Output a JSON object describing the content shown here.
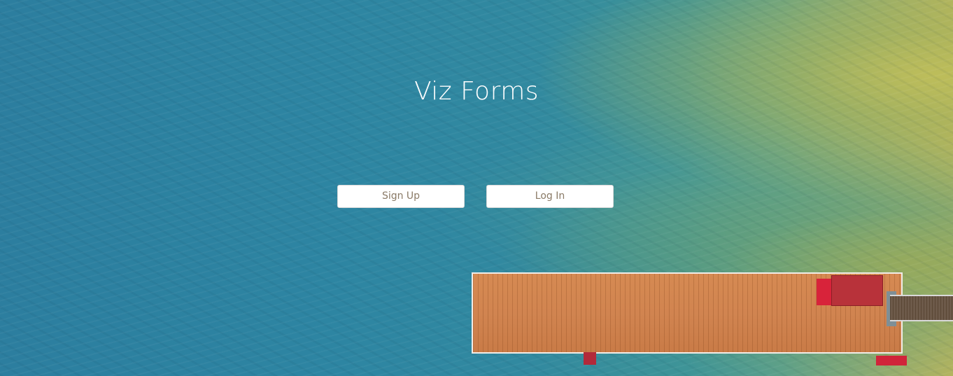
{
  "app": {
    "title": "Viz Forms"
  },
  "actions": {
    "signup_label": "Sign Up",
    "login_label": "Log In"
  },
  "colors": {
    "title_text": "#ffffff",
    "button_background": "#ffffff",
    "button_text": "#8a7a66"
  }
}
